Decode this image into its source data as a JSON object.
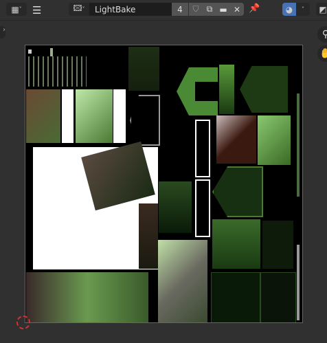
{
  "header": {
    "editor_type_icon": "image-editor-icon",
    "menu_icon": "hamburger-icon",
    "image_browse_icon": "image-icon",
    "image_name": "LightBake",
    "users_count": "4",
    "fake_user_icon": "shield-icon",
    "new_image_icon": "duplicate-icon",
    "open_image_icon": "folder-icon",
    "unlink_icon": "close-icon",
    "pin_icon": "pin-icon",
    "overlay_icon": "overlay-icon"
  },
  "accent": "#4772b3"
}
